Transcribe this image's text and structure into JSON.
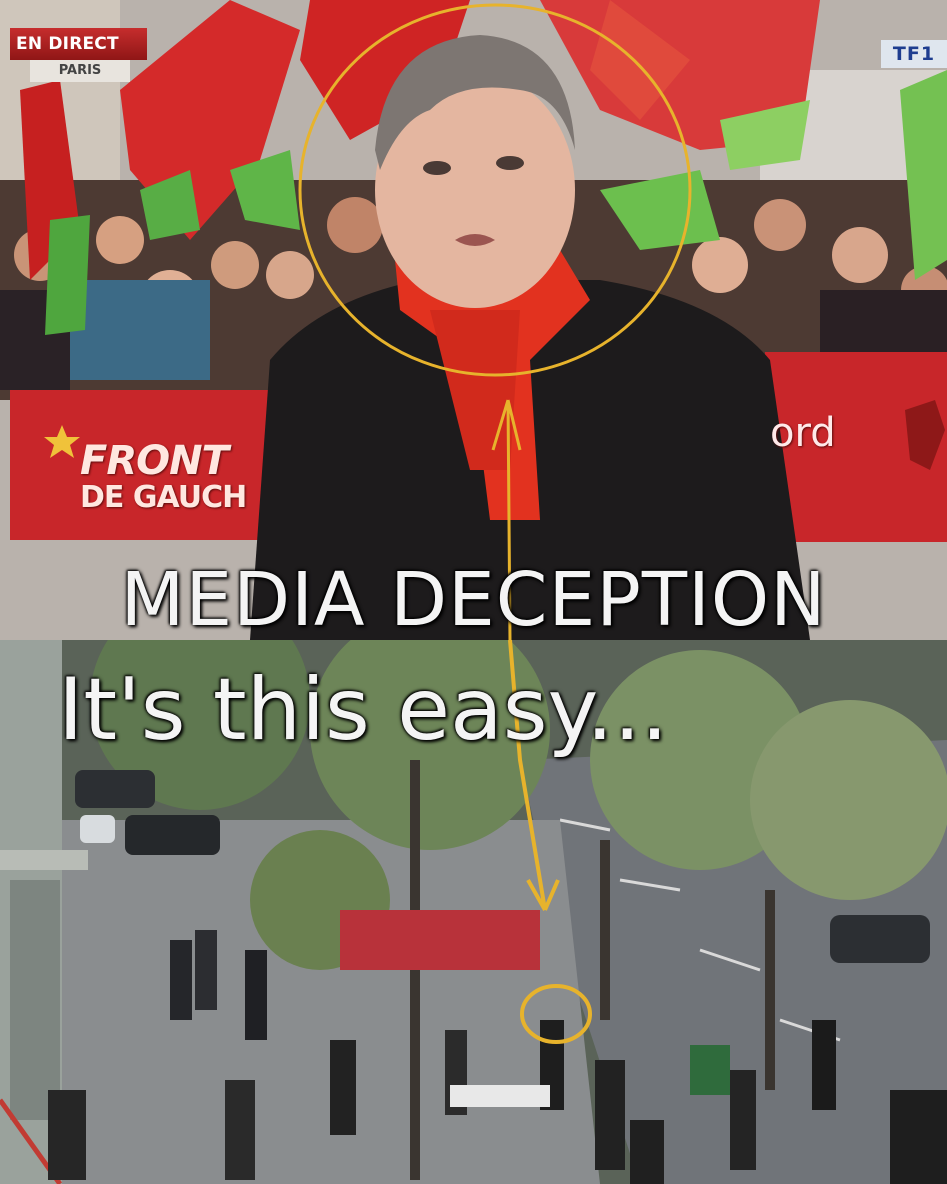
{
  "broadcast": {
    "live_label": "EN DIRECT",
    "location_label": "PARIS",
    "channel_logo": "TF1"
  },
  "banner": {
    "left_line_1": "FRONT",
    "left_line_2": "DE GAUCH",
    "right_fragment": "ord"
  },
  "caption": {
    "line_1": "MEDIA DECEPTION",
    "line_2": "It's this easy..."
  },
  "colors": {
    "highlight_circle": "#e7b32c",
    "scarf": "#e2321f",
    "flag_red": "#d42a2a",
    "flag_green": "#5fb548",
    "banner_red": "#c8262a"
  },
  "annotations": {
    "circle_icon": "highlight-circle",
    "arrow_icon": "up-arrow"
  }
}
